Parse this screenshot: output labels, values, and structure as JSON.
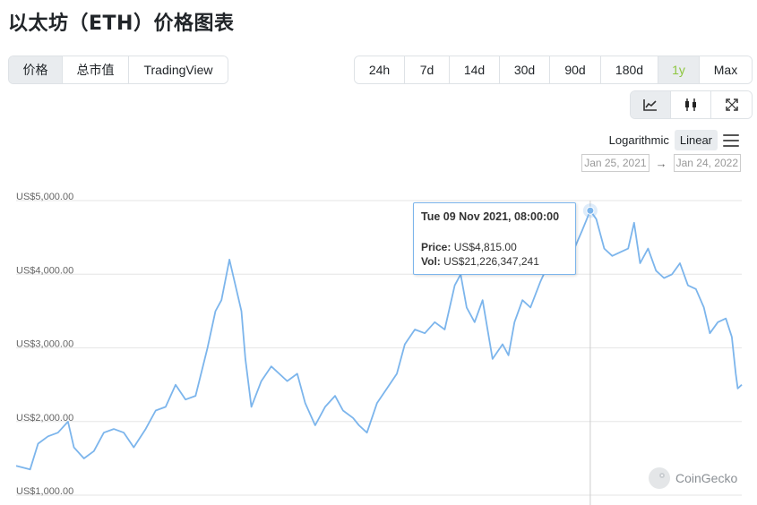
{
  "page": {
    "title": "以太坊（ETH）价格图表"
  },
  "view_tabs": [
    {
      "label": "价格",
      "active": true
    },
    {
      "label": "总市值",
      "active": false
    },
    {
      "label": "TradingView",
      "active": false
    }
  ],
  "range_tabs": [
    {
      "label": "24h"
    },
    {
      "label": "7d"
    },
    {
      "label": "14d"
    },
    {
      "label": "30d"
    },
    {
      "label": "90d"
    },
    {
      "label": "180d"
    },
    {
      "label": "1y",
      "active": true
    },
    {
      "label": "Max"
    }
  ],
  "tools": [
    {
      "icon": "line-chart-icon",
      "active": true
    },
    {
      "icon": "candlestick-icon",
      "active": false
    },
    {
      "icon": "fullscreen-icon",
      "active": false
    }
  ],
  "scale": {
    "logarithmic": "Logarithmic",
    "linear": "Linear",
    "selected": "Linear"
  },
  "date_range": {
    "from": "Jan 25, 2021",
    "arrow": "→",
    "to": "Jan 24, 2022"
  },
  "tooltip": {
    "date": "Tue 09 Nov 2021, 08:00:00",
    "price_label": "Price:",
    "price_value": "US$4,815.00",
    "vol_label": "Vol:",
    "vol_value": "US$21,226,347,241"
  },
  "watermark": "CoinGecko",
  "colors": {
    "line": "#7cb5ec",
    "accent_green": "#8dc63f",
    "grid": "#e6e6e6"
  },
  "chart_data": {
    "type": "line",
    "title": "",
    "xlabel": "",
    "ylabel": "",
    "x_range": [
      "2021-01-25",
      "2022-01-24"
    ],
    "ylim": [
      1000,
      5000
    ],
    "yticks": [
      {
        "value": 1000,
        "label": "US$1,000.00"
      },
      {
        "value": 2000,
        "label": "US$2,000.00"
      },
      {
        "value": 3000,
        "label": "US$3,000.00"
      },
      {
        "value": 4000,
        "label": "US$4,000.00"
      },
      {
        "value": 5000,
        "label": "US$5,000.00"
      }
    ],
    "grid": true,
    "highlight": {
      "date": "2021-11-09",
      "value": 4815
    },
    "series": [
      {
        "points": [
          [
            "2021-01-25",
            1350
          ],
          [
            "2021-02-01",
            1300
          ],
          [
            "2021-02-05",
            1650
          ],
          [
            "2021-02-10",
            1750
          ],
          [
            "2021-02-15",
            1800
          ],
          [
            "2021-02-20",
            1950
          ],
          [
            "2021-02-23",
            1600
          ],
          [
            "2021-02-28",
            1450
          ],
          [
            "2021-03-05",
            1550
          ],
          [
            "2021-03-10",
            1800
          ],
          [
            "2021-03-15",
            1850
          ],
          [
            "2021-03-20",
            1800
          ],
          [
            "2021-03-25",
            1600
          ],
          [
            "2021-03-31",
            1850
          ],
          [
            "2021-04-05",
            2100
          ],
          [
            "2021-04-10",
            2150
          ],
          [
            "2021-04-15",
            2450
          ],
          [
            "2021-04-20",
            2250
          ],
          [
            "2021-04-25",
            2300
          ],
          [
            "2021-05-01",
            2950
          ],
          [
            "2021-05-05",
            3450
          ],
          [
            "2021-05-08",
            3600
          ],
          [
            "2021-05-12",
            4150
          ],
          [
            "2021-05-15",
            3800
          ],
          [
            "2021-05-18",
            3450
          ],
          [
            "2021-05-20",
            2800
          ],
          [
            "2021-05-23",
            2150
          ],
          [
            "2021-05-28",
            2500
          ],
          [
            "2021-06-02",
            2700
          ],
          [
            "2021-06-06",
            2600
          ],
          [
            "2021-06-10",
            2500
          ],
          [
            "2021-06-15",
            2600
          ],
          [
            "2021-06-19",
            2200
          ],
          [
            "2021-06-24",
            1900
          ],
          [
            "2021-06-29",
            2150
          ],
          [
            "2021-07-04",
            2300
          ],
          [
            "2021-07-08",
            2100
          ],
          [
            "2021-07-13",
            2000
          ],
          [
            "2021-07-16",
            1900
          ],
          [
            "2021-07-20",
            1800
          ],
          [
            "2021-07-25",
            2200
          ],
          [
            "2021-07-30",
            2400
          ],
          [
            "2021-08-04",
            2600
          ],
          [
            "2021-08-08",
            3000
          ],
          [
            "2021-08-13",
            3200
          ],
          [
            "2021-08-18",
            3150
          ],
          [
            "2021-08-23",
            3300
          ],
          [
            "2021-08-28",
            3200
          ],
          [
            "2021-09-02",
            3800
          ],
          [
            "2021-09-05",
            3950
          ],
          [
            "2021-09-08",
            3500
          ],
          [
            "2021-09-12",
            3300
          ],
          [
            "2021-09-16",
            3600
          ],
          [
            "2021-09-21",
            2800
          ],
          [
            "2021-09-26",
            3000
          ],
          [
            "2021-09-29",
            2850
          ],
          [
            "2021-10-02",
            3300
          ],
          [
            "2021-10-06",
            3600
          ],
          [
            "2021-10-10",
            3500
          ],
          [
            "2021-10-15",
            3850
          ],
          [
            "2021-10-20",
            4150
          ],
          [
            "2021-10-24",
            4050
          ],
          [
            "2021-10-28",
            4300
          ],
          [
            "2021-11-01",
            4300
          ],
          [
            "2021-11-05",
            4550
          ],
          [
            "2021-11-09",
            4815
          ],
          [
            "2021-11-12",
            4700
          ],
          [
            "2021-11-16",
            4300
          ],
          [
            "2021-11-20",
            4200
          ],
          [
            "2021-11-24",
            4250
          ],
          [
            "2021-11-28",
            4300
          ],
          [
            "2021-12-01",
            4650
          ],
          [
            "2021-12-04",
            4100
          ],
          [
            "2021-12-08",
            4300
          ],
          [
            "2021-12-12",
            4000
          ],
          [
            "2021-12-16",
            3900
          ],
          [
            "2021-12-20",
            3950
          ],
          [
            "2021-12-24",
            4100
          ],
          [
            "2021-12-28",
            3800
          ],
          [
            "2022-01-01",
            3750
          ],
          [
            "2022-01-05",
            3500
          ],
          [
            "2022-01-08",
            3150
          ],
          [
            "2022-01-12",
            3300
          ],
          [
            "2022-01-16",
            3350
          ],
          [
            "2022-01-19",
            3100
          ],
          [
            "2022-01-21",
            2600
          ],
          [
            "2022-01-22",
            2400
          ],
          [
            "2022-01-24",
            2450
          ]
        ]
      }
    ]
  }
}
